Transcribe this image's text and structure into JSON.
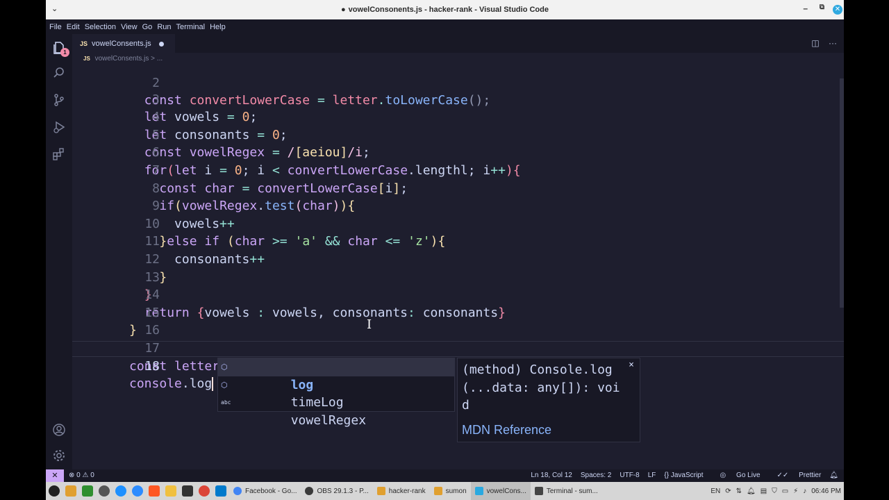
{
  "window": {
    "title": "vowelConsonents.js - hacker-rank - Visual Studio Code",
    "title_dot": "●"
  },
  "menu": [
    "File",
    "Edit",
    "Selection",
    "View",
    "Go",
    "Run",
    "Terminal",
    "Help"
  ],
  "activity": {
    "badge": "1"
  },
  "tab": {
    "lang": "JS",
    "name": "vowelConsents.js"
  },
  "breadcrumb": {
    "lang": "JS",
    "path": "vowelConsents.js > ..."
  },
  "editor": {
    "lines": [
      {
        "n": "2",
        "text": "  const convertLowerCase = letter.toLowerCase();"
      },
      {
        "n": "3",
        "text": "  let vowels = 0;"
      },
      {
        "n": "4",
        "text": "  let consonants = 0;"
      },
      {
        "n": "5",
        "text": "  const vowelRegex = /[aeiou]/i;"
      },
      {
        "n": "6",
        "text": "  for(let i = 0; i < convertLowerCase.lengthl; i++){"
      },
      {
        "n": "7",
        "text": "    const char = convertLowerCase[i];"
      },
      {
        "n": "8",
        "text": "    if(vowelRegex.test(char)){"
      },
      {
        "n": "9",
        "text": "      vowels++"
      },
      {
        "n": "10",
        "text": "    }else if (char >= 'a' && char <= 'z'){"
      },
      {
        "n": "11",
        "text": "      consonants++"
      },
      {
        "n": "12",
        "text": "    }"
      },
      {
        "n": "13",
        "text": "  }"
      },
      {
        "n": "14",
        "text": "  return {vowels : vowels, consonants: consonants}"
      },
      {
        "n": "15",
        "text": "}"
      },
      {
        "n": "16",
        "text": ""
      },
      {
        "n": "17",
        "text": "const letter = 'world';"
      },
      {
        "n": "18",
        "text": "console.log"
      }
    ]
  },
  "suggest": {
    "items": [
      {
        "icon": "method-icon",
        "label": "log",
        "selected": true
      },
      {
        "icon": "method-icon",
        "label": "timeLog",
        "selected": false
      },
      {
        "icon": "text-icon",
        "label": "vowelRegex",
        "selected": false
      }
    ],
    "details": {
      "signature": "(method) Console.log(...data: any[]): void",
      "link": "MDN Reference",
      "close": "×"
    }
  },
  "status": {
    "remote": "✕",
    "problems": "⊗ 0 ⚠ 0",
    "position": "Ln 18, Col 12",
    "spaces": "Spaces: 2",
    "encoding": "UTF-8",
    "eol": "LF",
    "language": "{} JavaScript",
    "golive": "Go Live",
    "prettier": "Prettier"
  },
  "taskbar": {
    "tasks": [
      {
        "label": "Facebook - Go...",
        "color": "#4285f4"
      },
      {
        "label": "OBS 29.1.3 - P...",
        "color": "#3a3a3a"
      },
      {
        "label": "hacker-rank",
        "color": "#e0a030"
      },
      {
        "label": "sumon",
        "color": "#e0a030"
      },
      {
        "label": "vowelCons...",
        "color": "#2aa9e0"
      },
      {
        "label": "Terminal - sum...",
        "color": "#444444"
      }
    ],
    "lang": "EN",
    "clock": "06:46 PM"
  },
  "colors": {
    "accent": "#cba6f7",
    "background": "#1e1e2e",
    "link": "#89b4fa"
  }
}
